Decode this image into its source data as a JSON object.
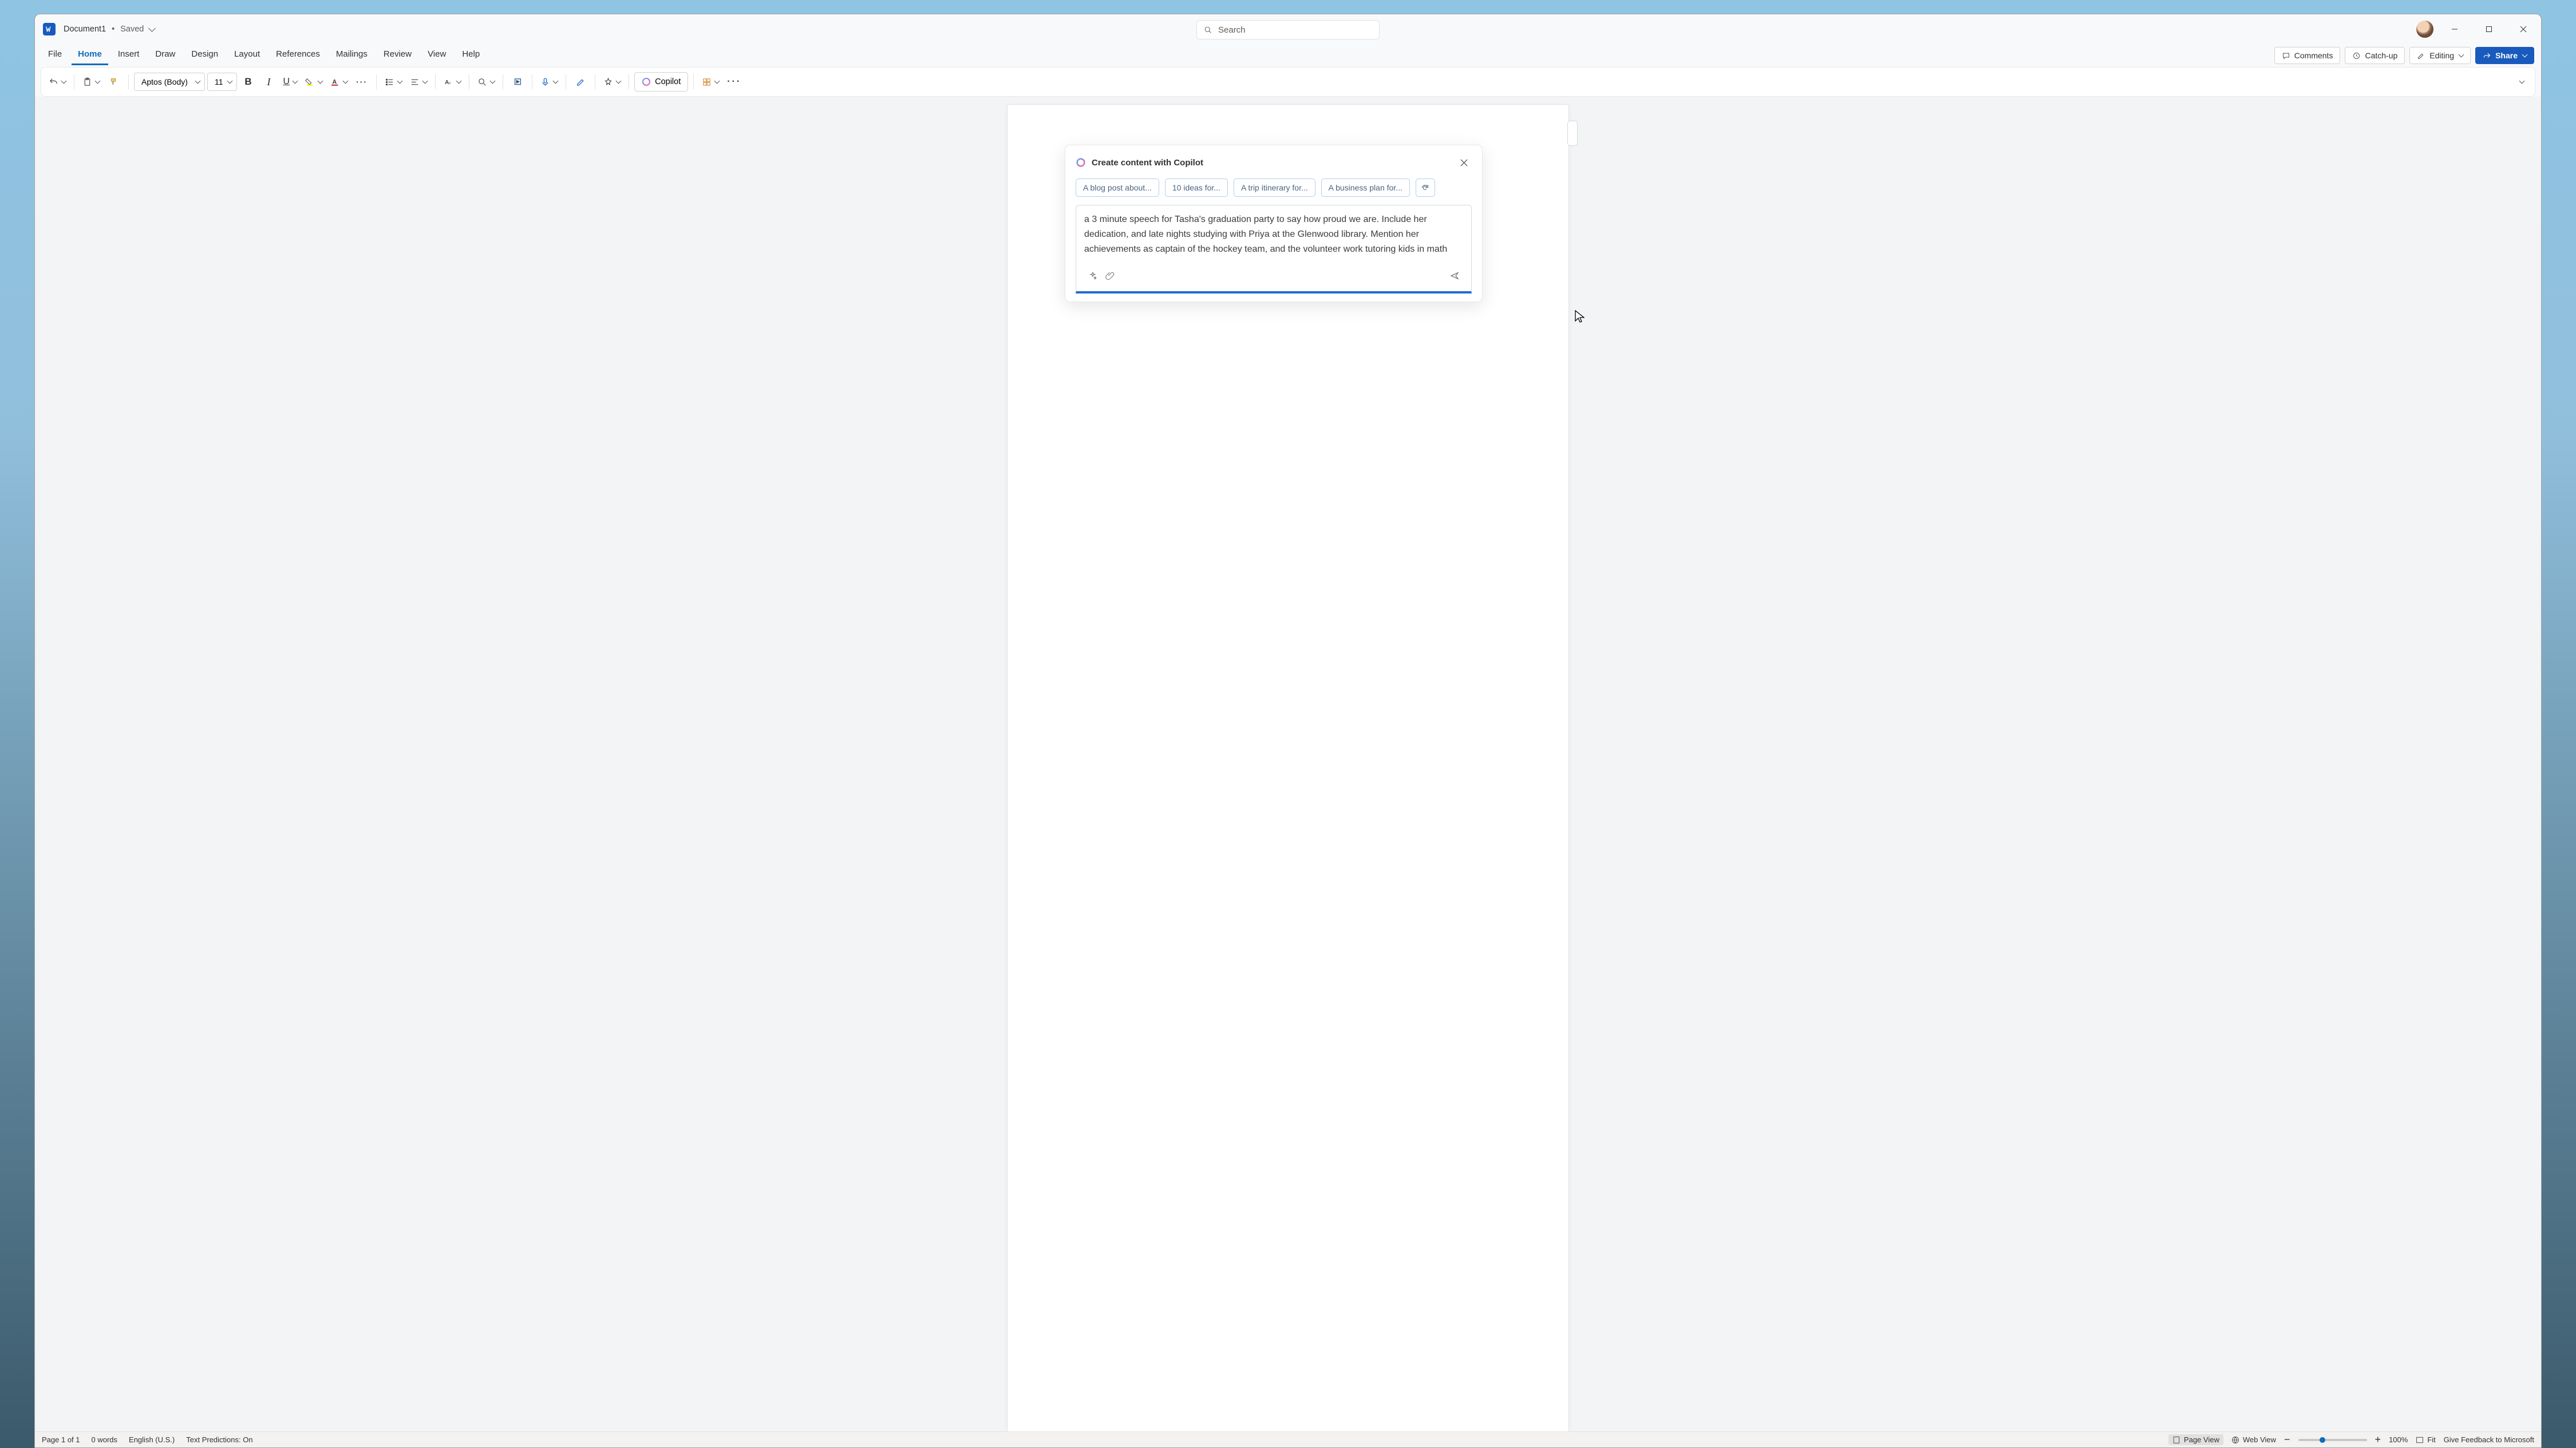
{
  "titlebar": {
    "doc_name": "Document1",
    "save_state": "Saved",
    "search_placeholder": "Search"
  },
  "tabs": {
    "items": [
      "File",
      "Home",
      "Insert",
      "Draw",
      "Design",
      "Layout",
      "References",
      "Mailings",
      "Review",
      "View",
      "Help"
    ],
    "active_index": 1,
    "comments": "Comments",
    "catchup": "Catch-up",
    "editing": "Editing",
    "share": "Share"
  },
  "ribbon": {
    "font_name": "Aptos (Body)",
    "font_size": "11",
    "copilot_btn": "Copilot"
  },
  "copilot": {
    "title": "Create content with Copilot",
    "chips": [
      "A blog post about...",
      "10 ideas for...",
      "A trip itinerary for...",
      "A business plan for..."
    ],
    "prompt": "a 3 minute speech for Tasha's graduation party to say how proud we are. Include her dedication, and late nights studying with Priya at the Glenwood library. Mention her achievements as captain of the hockey team, and the volunteer work tutoring kids in math"
  },
  "status": {
    "page": "Page 1 of 1",
    "words": "0 words",
    "lang": "English (U.S.)",
    "predictions": "Text Predictions: On",
    "view_page": "Page View",
    "view_web": "Web View",
    "zoom": "100%",
    "fit": "Fit",
    "feedback": "Give Feedback to Microsoft"
  }
}
